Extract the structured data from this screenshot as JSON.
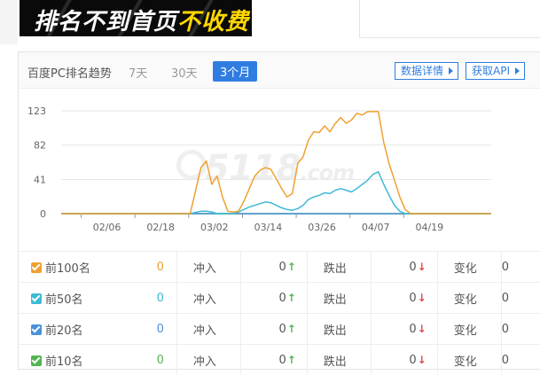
{
  "banner": {
    "text_main": "排名不到首页",
    "text_highlight": "不收费"
  },
  "panel": {
    "title": "百度PC排名趋势",
    "tabs": [
      {
        "label": "7天",
        "active": false
      },
      {
        "label": "30天",
        "active": false
      },
      {
        "label": "3个月",
        "active": true
      }
    ],
    "buttons": {
      "details": "数据详情",
      "api": "获取API"
    }
  },
  "watermark": {
    "main": "5118",
    "suffix": ".com"
  },
  "chart_data": {
    "type": "line",
    "x": [
      "02/06",
      "02/18",
      "03/02",
      "03/14",
      "03/26",
      "04/07",
      "04/19"
    ],
    "x_ticks": [
      "02/06",
      "02/18",
      "03/02",
      "03/14",
      "03/26",
      "04/07",
      "04/19"
    ],
    "y_ticks": [
      "123",
      "82",
      "41",
      "0"
    ],
    "ylim": [
      0,
      123
    ],
    "grid": true,
    "series": [
      {
        "name": "前100名",
        "color": "#f0a030",
        "points": [
          [
            0,
            0
          ],
          [
            20,
            0
          ],
          [
            24,
            0
          ],
          [
            26,
            55
          ],
          [
            27,
            63
          ],
          [
            28,
            35
          ],
          [
            29,
            45
          ],
          [
            30,
            20
          ],
          [
            31,
            3
          ],
          [
            32,
            2
          ],
          [
            33,
            3
          ],
          [
            34,
            15
          ],
          [
            36,
            45
          ],
          [
            37,
            52
          ],
          [
            38,
            55
          ],
          [
            39,
            53
          ],
          [
            40,
            42
          ],
          [
            41,
            30
          ],
          [
            42,
            20
          ],
          [
            43,
            24
          ],
          [
            44,
            60
          ],
          [
            45,
            68
          ],
          [
            46,
            88
          ],
          [
            47,
            98
          ],
          [
            48,
            97
          ],
          [
            49,
            105
          ],
          [
            50,
            98
          ],
          [
            51,
            108
          ],
          [
            52,
            115
          ],
          [
            53,
            108
          ],
          [
            54,
            112
          ],
          [
            55,
            120
          ],
          [
            56,
            118
          ],
          [
            57,
            122
          ],
          [
            58,
            122
          ],
          [
            59,
            122
          ],
          [
            60,
            85
          ],
          [
            61,
            60
          ],
          [
            62,
            40
          ],
          [
            63,
            20
          ],
          [
            64,
            5
          ],
          [
            65,
            0
          ],
          [
            80,
            0
          ]
        ]
      },
      {
        "name": "前50名",
        "color": "#3dbad6",
        "points": [
          [
            0,
            0
          ],
          [
            24,
            0
          ],
          [
            26,
            3
          ],
          [
            27,
            3
          ],
          [
            28,
            2
          ],
          [
            29,
            0
          ],
          [
            32,
            0
          ],
          [
            33,
            2
          ],
          [
            35,
            8
          ],
          [
            37,
            12
          ],
          [
            38,
            14
          ],
          [
            39,
            13
          ],
          [
            40,
            10
          ],
          [
            41,
            7
          ],
          [
            42,
            5
          ],
          [
            43,
            4
          ],
          [
            44,
            6
          ],
          [
            45,
            10
          ],
          [
            46,
            17
          ],
          [
            47,
            20
          ],
          [
            48,
            22
          ],
          [
            49,
            25
          ],
          [
            50,
            24
          ],
          [
            51,
            28
          ],
          [
            52,
            30
          ],
          [
            53,
            28
          ],
          [
            54,
            26
          ],
          [
            55,
            30
          ],
          [
            56,
            35
          ],
          [
            57,
            40
          ],
          [
            58,
            47
          ],
          [
            59,
            50
          ],
          [
            60,
            35
          ],
          [
            61,
            22
          ],
          [
            62,
            10
          ],
          [
            63,
            3
          ],
          [
            64,
            0
          ],
          [
            80,
            0
          ]
        ]
      },
      {
        "name": "前20名",
        "color": "#4a90d9",
        "points": [
          [
            0,
            0
          ],
          [
            80,
            0
          ]
        ]
      },
      {
        "name": "前10名",
        "color": "#52b552",
        "points": [
          [
            0,
            0
          ],
          [
            80,
            0
          ]
        ]
      }
    ]
  },
  "stats": {
    "col_labels": {
      "up": "冲入",
      "down": "跌出",
      "change": "变化"
    },
    "rows": [
      {
        "name": "前100名",
        "count": "0",
        "count_color": "#f0a030",
        "check_color": "#f0a030",
        "up": "0",
        "down": "0",
        "change": "0"
      },
      {
        "name": "前50名",
        "count": "0",
        "count_color": "#3dbad6",
        "check_color": "#3dbad6",
        "up": "0",
        "down": "0",
        "change": "0"
      },
      {
        "name": "前20名",
        "count": "0",
        "count_color": "#4a90d9",
        "check_color": "#4a90d9",
        "up": "0",
        "down": "0",
        "change": "0"
      },
      {
        "name": "前10名",
        "count": "0",
        "count_color": "#52b552",
        "check_color": "#52b552",
        "up": "0",
        "down": "0",
        "change": "0"
      }
    ]
  },
  "colors": {
    "accent": "#2f7de1",
    "up": "#52b552",
    "down": "#e04a4a"
  }
}
